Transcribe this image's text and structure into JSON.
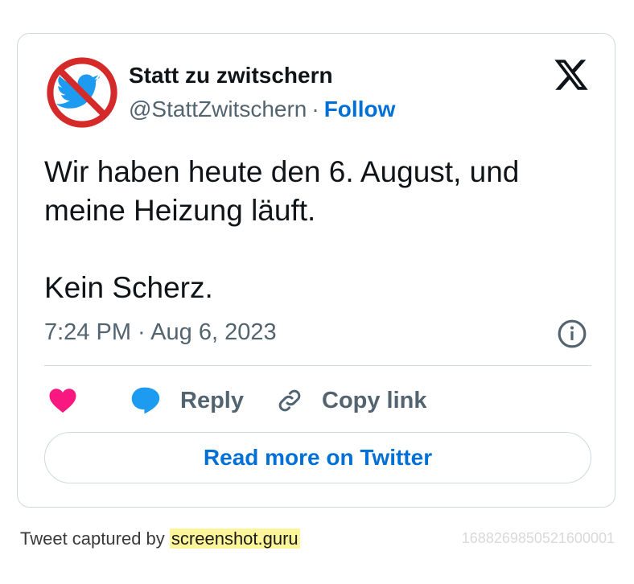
{
  "author": {
    "name": "Statt zu zwitschern",
    "handle": "@StattZwitschern",
    "separator": "·",
    "follow_label": "Follow",
    "avatar_icon": "no-twitter-bird-icon"
  },
  "platform_icon": "x-logo-icon",
  "tweet": {
    "lines": [
      "Wir haben heute den 6. August, und",
      "meine Heizung läuft."
    ],
    "second_paragraph": "Kein Scherz.",
    "timestamp": "7:24 PM · Aug 6, 2023"
  },
  "actions": {
    "like_icon": "heart-icon",
    "reply_label": "Reply",
    "copy_label": "Copy link"
  },
  "read_more_label": "Read more on Twitter",
  "footer": {
    "captured_by": "Tweet captured by",
    "brand": "screenshot.guru",
    "id": "1688269850521600001"
  },
  "colors": {
    "accent": "#006fd6",
    "like": "#f91880",
    "reply": "#1d9bf0",
    "muted": "#536471",
    "border": "#cfd9de"
  }
}
